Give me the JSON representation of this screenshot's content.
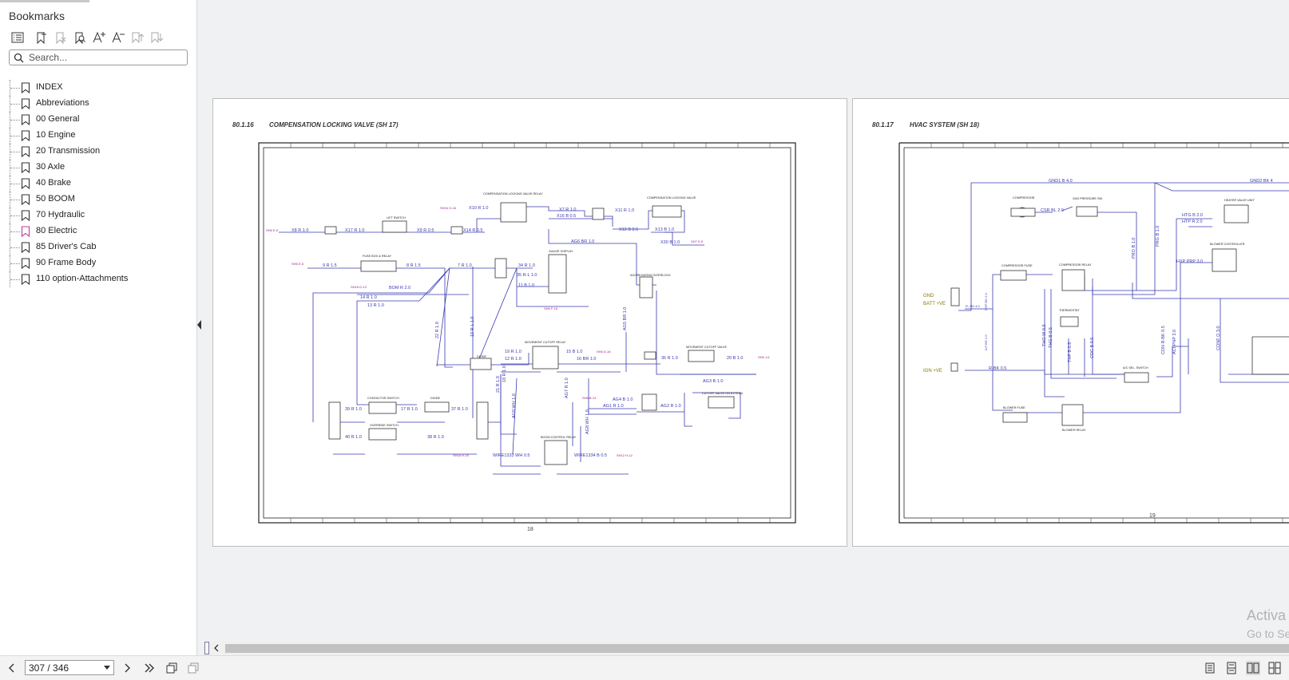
{
  "sidebar": {
    "title": "Bookmarks",
    "search_placeholder": "Search...",
    "items": [
      {
        "label": "INDEX"
      },
      {
        "label": "Abbreviations"
      },
      {
        "label": "00 General"
      },
      {
        "label": "10 Engine"
      },
      {
        "label": "20 Transmission"
      },
      {
        "label": "30 Axle"
      },
      {
        "label": "40 Brake"
      },
      {
        "label": "50 BOOM"
      },
      {
        "label": "70 Hydraulic"
      },
      {
        "label": "80 Electric"
      },
      {
        "label": "85 Driver's Cab"
      },
      {
        "label": "90 Frame Body"
      },
      {
        "label": "110 option-Attachments"
      }
    ]
  },
  "pages": [
    {
      "section": "80.1.16",
      "title": "COMPENSATION LOCKING VALVE (SH 17)",
      "page_number": "18"
    },
    {
      "section": "80.1.17",
      "title": "HVAC SYSTEM (SH 18)",
      "page_number": "19"
    }
  ],
  "diagram_left": {
    "wires": [
      "X8 R 1.0",
      "X17 R 1.0",
      "X9 R 0.5",
      "X14 R 0.5",
      "X10 R 1.0",
      "X7 R 1.0",
      "X16 B 0.5",
      "X11 R 1.0",
      "X12 B 0.5",
      "X13 B 1.0",
      "X30 B 1.0",
      "AG6 BR 1.0",
      "9 R 1.5",
      "8 R 1.5",
      "7 R 1.0",
      "34 R 1.0",
      "35 R-L 1.0",
      "11 B 1.0",
      "BOM R 2.0",
      "14 R 1.0",
      "13 R 1.0",
      "19 R 1.0",
      "12 R 1.0",
      "15 B 1.0",
      "16 BR 1.0",
      "36 R 1.0",
      "20 B 1.0",
      "AG3 B 1.0",
      "AG4 B 1.0",
      "AG1 R 1.0",
      "AG2 R 1.0",
      "39 R 1.0",
      "17 R 1.0",
      "37 R 1.0",
      "40 R 1.0",
      "38 R 1.0",
      "WIRE1333 WH 0.5",
      "WIRE1334 B 0.5",
      "22 R 1.0",
      "10 R-L 1.0",
      "AG5 BR 1.0",
      "21 R 1.0",
      "18 R 1.0",
      "AG9 WH 1.0",
      "AG7 R 1.0",
      "AG8 WH 1.0"
    ],
    "components": [
      "COMPENSATION LOCKING VALVE RELAY",
      "COMPENSATION LOCKING VALVE",
      "LIFT SWITCH",
      "FUSE BOX & RELAY",
      "GAUGE DISPLAY",
      "AGGREGATING INTERLOCK",
      "MOVEMENT CUTOFF RELAY",
      "MOVEMENT CUTOFF VALVE",
      "CUTOFF VALVE ON EXTEND",
      "CONTACTOR SWITCH",
      "OVERRIDE SWITCH",
      "DIODE",
      "BOOM CONTROL RELAY"
    ]
  },
  "diagram_right": {
    "wires": [
      "GND1 B 4.0",
      "GND2 BK 4",
      "CSR BL 2.0",
      "HTG B 2.0",
      "HTP R 2.0",
      "PRO B 1.0",
      "PRG B 1.0",
      "THO W 0.5",
      "THG B 0.5",
      "THP B 0.5",
      "CDC B 0.5",
      "CDN R-BK 0.5",
      "ACI PNP 3.0",
      "CONF O 3.0",
      "R-BK 0.5",
      "HXP PRP 3.0"
    ],
    "labels": [
      "GND",
      "BATT +VE",
      "IGN +VE"
    ],
    "components": [
      "COMPRESSOR",
      "GAS PRESSURE SW.",
      "HEATER VALVE UNIT",
      "BLOWER CONTROLLER",
      "COMPRESSOR FUSE",
      "COMPRESSOR RELAY",
      "THERMOSTAT",
      "A/C SEL. SWITCH",
      "BLOWER FUSE",
      "BLOWER RELAY"
    ]
  },
  "statusbar": {
    "page_indicator": "307 / 346"
  },
  "watermark": {
    "line1": "Activa",
    "line2": "Go to Se"
  }
}
